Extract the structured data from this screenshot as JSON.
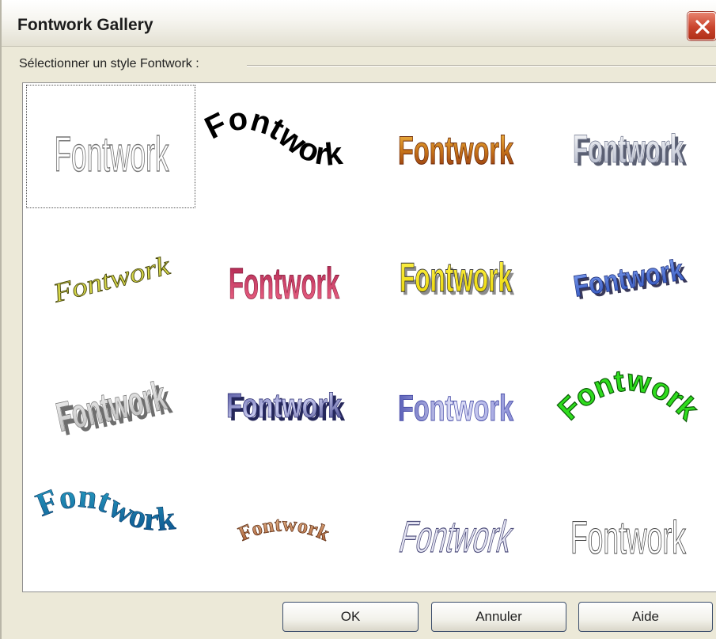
{
  "window": {
    "title": "Fontwork Gallery"
  },
  "group_label": "Sélectionner un style Fontwork :",
  "gallery": {
    "items": [
      {
        "text": "Fontwork",
        "style": "outline-narrow",
        "selected": true
      },
      {
        "text": "Fontwork",
        "style": "black-wave"
      },
      {
        "text": "Fontwork",
        "style": "orange-gradient"
      },
      {
        "text": "Fontwork",
        "style": "silver-3d"
      },
      {
        "text": "Fontwork",
        "style": "olive-slant"
      },
      {
        "text": "Fontwork",
        "style": "pink-perspective"
      },
      {
        "text": "Fontwork",
        "style": "yellow-bold"
      },
      {
        "text": "Fontwork",
        "style": "blue-3d-slant"
      },
      {
        "text": "Fontwork",
        "style": "grey-3d-extrude"
      },
      {
        "text": "Fontwork",
        "style": "navy-3d"
      },
      {
        "text": "Fontwork",
        "style": "lavender-perspective"
      },
      {
        "text": "Fontwork",
        "style": "green-arch"
      },
      {
        "text": "Fontwork",
        "style": "teal-wave"
      },
      {
        "text": "Fontwork",
        "style": "tan-arch"
      },
      {
        "text": "Fontwork",
        "style": "slanted-outline"
      },
      {
        "text": "Fontwork",
        "style": "outline-plain"
      }
    ]
  },
  "buttons": {
    "ok": "OK",
    "cancel": "Annuler",
    "help": "Aide"
  },
  "colors": {
    "close_red": "#c9432c",
    "selection_border": "#555555"
  }
}
